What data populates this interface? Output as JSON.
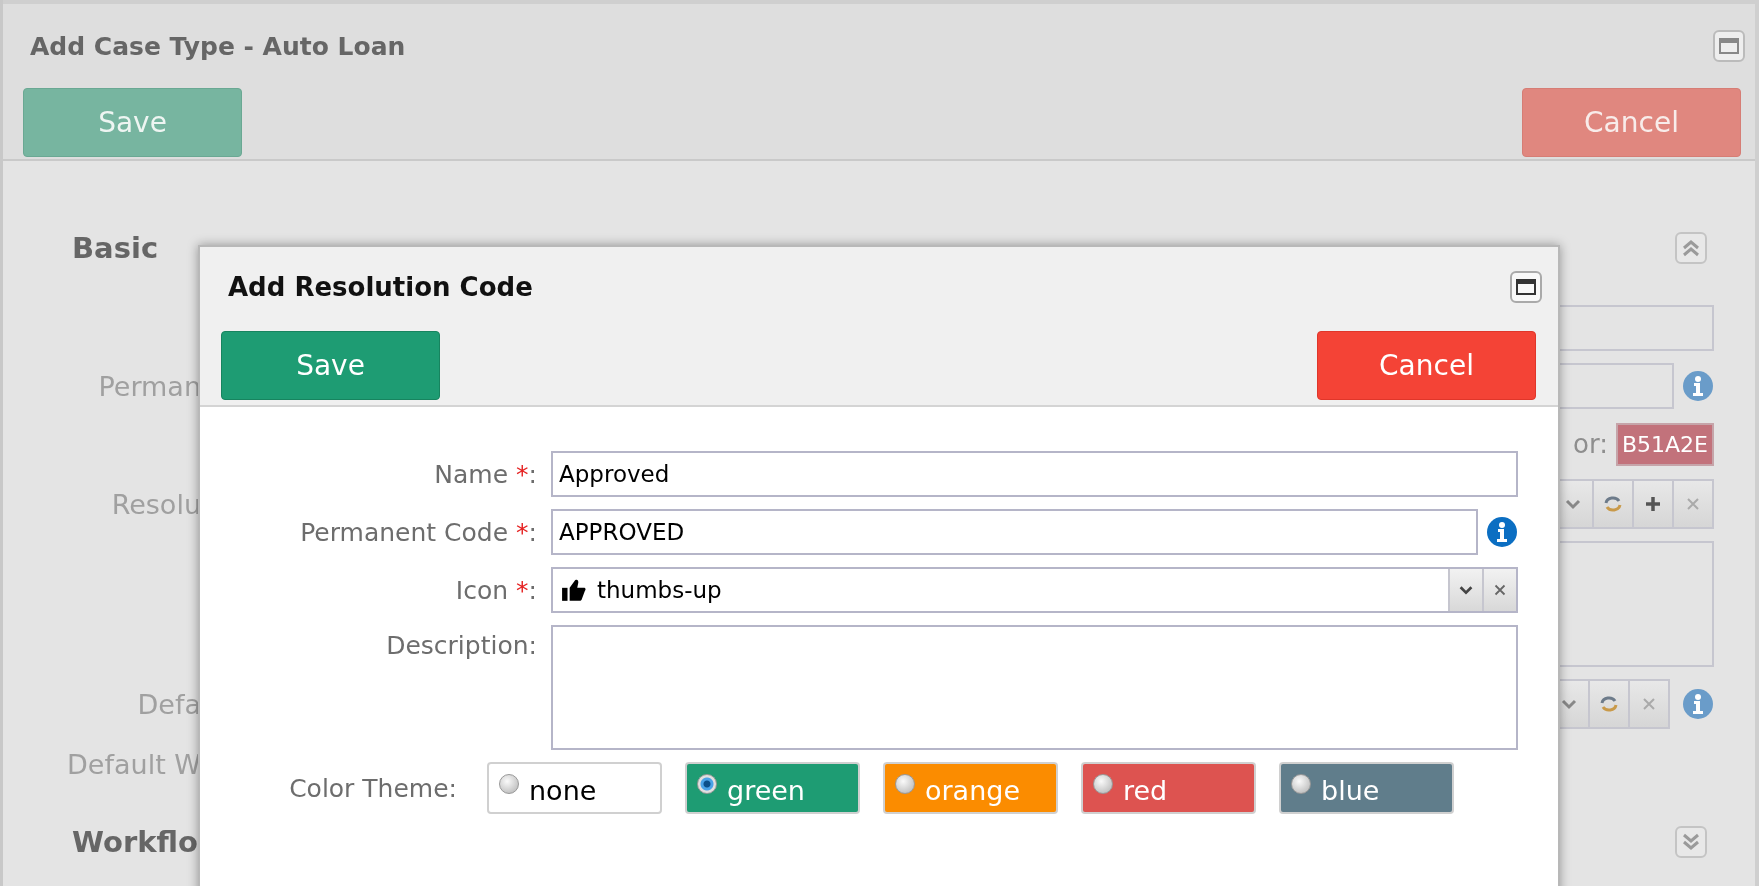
{
  "page": {
    "title": "Add Case Type - Auto Loan",
    "buttons": [
      {
        "label": "Save",
        "kind": "save"
      },
      {
        "label": "Cancel",
        "kind": "cancel"
      }
    ],
    "sections": [
      {
        "title": "Basic",
        "expanded": true,
        "rows": [
          {
            "kind": "text"
          },
          {
            "kind": "text_info",
            "label": "Perman"
          },
          {
            "kind": "color",
            "side_label": "or:",
            "value": "B51A2E"
          },
          {
            "kind": "combo_add",
            "label": "Resolu"
          },
          {
            "kind": "textarea"
          },
          {
            "kind": "combo_info",
            "label": "Defa"
          },
          {
            "kind": "label_only",
            "label": "Default W"
          }
        ]
      },
      {
        "title": "Workflo",
        "expanded": false
      }
    ]
  },
  "dialog": {
    "title": "Add Resolution Code",
    "buttons": [
      {
        "label": "Save",
        "kind": "save"
      },
      {
        "label": "Cancel",
        "kind": "cancel"
      }
    ],
    "fields": [
      {
        "label": "Name",
        "required_mark": "*",
        "colon": ":",
        "kind": "text",
        "value": "Approved"
      },
      {
        "label": "Permanent Code",
        "required_mark": "*",
        "colon": ":",
        "kind": "text_info",
        "value": "APPROVED"
      },
      {
        "label": "Icon",
        "required_mark": "*",
        "colon": ":",
        "kind": "icon_select",
        "value": "thumbs-up"
      },
      {
        "label": "Description",
        "colon": ":",
        "kind": "textarea"
      }
    ],
    "color_theme": {
      "label": "Color Theme:",
      "options": [
        {
          "label": "none",
          "kind": "plain",
          "color": "#ffffff",
          "selected": false
        },
        {
          "label": "green",
          "kind": "swatch",
          "color": "#1e9c73",
          "selected": true
        },
        {
          "label": "orange",
          "kind": "swatch",
          "color": "#fb8c00",
          "selected": false
        },
        {
          "label": "red",
          "kind": "swatch",
          "color": "#dd5350",
          "selected": false
        },
        {
          "label": "blue",
          "kind": "swatch",
          "color": "#607d8b",
          "selected": false
        }
      ]
    }
  }
}
